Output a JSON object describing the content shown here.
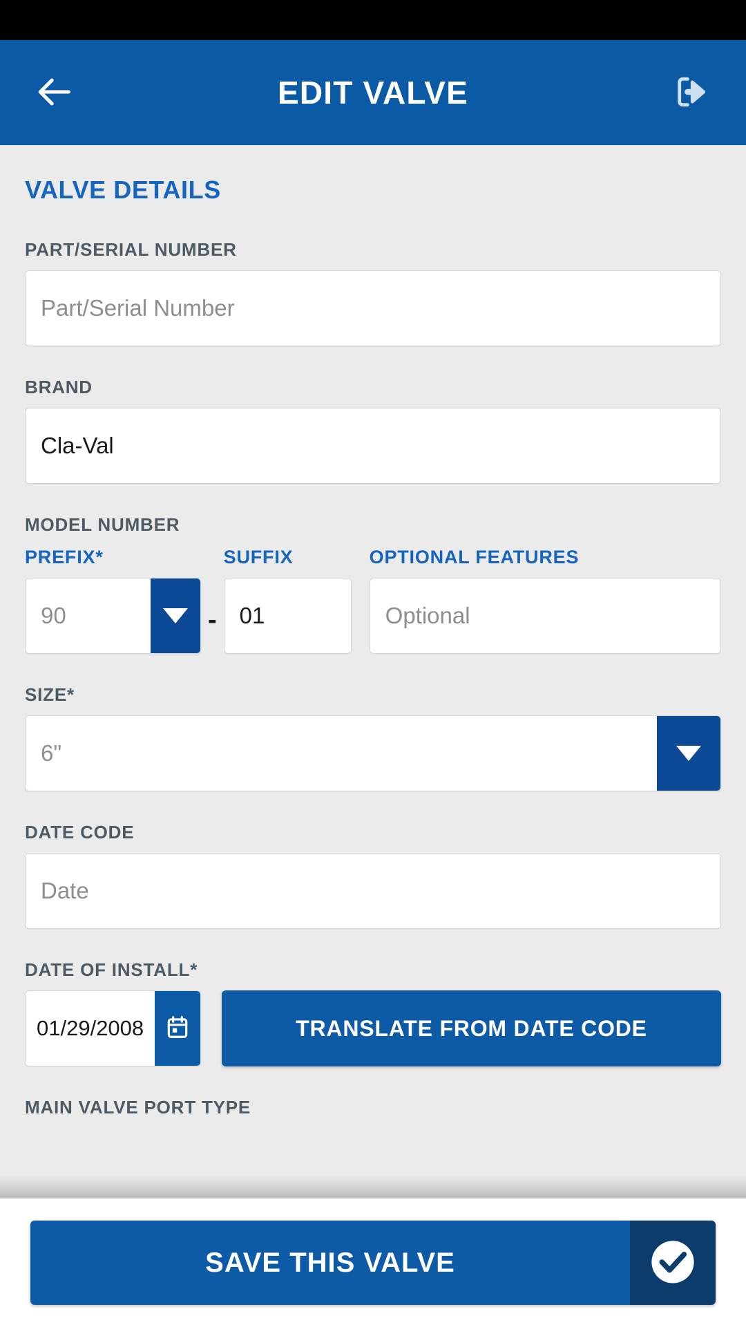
{
  "theme": {
    "header_blue": "#0a5aa5",
    "accent_blue": "#1565c0",
    "button_blue": "#0d5ba6",
    "dropdown_blue": "#0d4a96",
    "save_check_blue": "#0b3c6b",
    "page_background": "#ebebeb",
    "label_gray": "#4d5a66",
    "placeholder_gray": "#8e8e8e"
  },
  "header": {
    "title": "EDIT VALVE",
    "back_icon": "arrow-left-icon",
    "exit_icon": "exit-logout-icon"
  },
  "form": {
    "section_title": "VALVE DETAILS",
    "part_serial": {
      "label": "PART/SERIAL NUMBER",
      "value": "",
      "placeholder": "Part/Serial Number"
    },
    "brand": {
      "label": "BRAND",
      "value": "Cla-Val",
      "placeholder": "Brand"
    },
    "model_number": {
      "label": "MODEL NUMBER",
      "prefix": {
        "label": "PREFIX*",
        "value": "90",
        "is_placeholder": true,
        "icon": "chevron-down-icon"
      },
      "separator": "-",
      "suffix": {
        "label": "SUFFIX",
        "value": "01",
        "placeholder": "Suffix"
      },
      "optional_features": {
        "label": "OPTIONAL FEATURES",
        "value": "",
        "placeholder": "Optional"
      }
    },
    "size": {
      "label": "SIZE*",
      "value": "6\"",
      "is_placeholder": true,
      "icon": "chevron-down-icon"
    },
    "date_code": {
      "label": "DATE CODE",
      "value": "",
      "placeholder": "Date"
    },
    "date_of_install": {
      "label": "DATE OF INSTALL*",
      "value": "01/29/2008",
      "calendar_icon": "calendar-icon",
      "translate_button": "TRANSLATE FROM DATE CODE"
    },
    "next_field_partial": {
      "label": "MAIN VALVE PORT TYPE"
    }
  },
  "bottom_bar": {
    "save_label": "SAVE THIS VALVE",
    "check_icon": "check-circle-icon"
  }
}
